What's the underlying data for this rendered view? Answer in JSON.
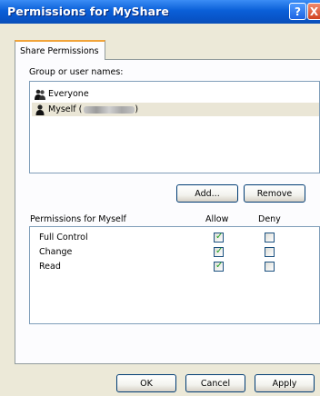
{
  "window": {
    "title": "Permissions for MyShare",
    "help_glyph": "?",
    "close_glyph": "X"
  },
  "tab": {
    "label": "Share Permissions"
  },
  "groups": {
    "label": "Group or user names:",
    "items": [
      {
        "name": "Everyone",
        "icon": "group-icon"
      },
      {
        "name": "Myself (",
        "suffix": ")",
        "icon": "user-icon",
        "selected": true
      }
    ]
  },
  "buttons": {
    "add": "Add...",
    "remove": "Remove",
    "ok": "OK",
    "cancel": "Cancel",
    "apply": "Apply"
  },
  "permissions": {
    "label": "Permissions for Myself",
    "allow_header": "Allow",
    "deny_header": "Deny",
    "rows": [
      {
        "name": "Full Control",
        "allow": true,
        "deny": false
      },
      {
        "name": "Change",
        "allow": true,
        "deny": false
      },
      {
        "name": "Read",
        "allow": true,
        "deny": false
      }
    ]
  },
  "colors": {
    "title_bar": "#0a5fd8",
    "tab_accent": "#f1a43b",
    "check": "#21a121"
  }
}
